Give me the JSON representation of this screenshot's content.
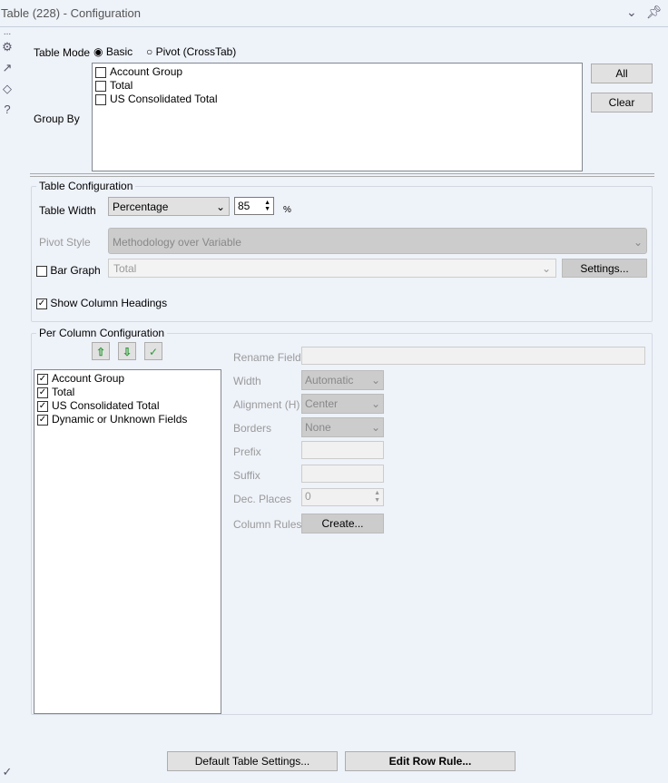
{
  "window": {
    "title": "Table (228) - Configuration",
    "ellipsis": "..."
  },
  "icons": {
    "collapse": "chevron-down-icon",
    "pin": "pin-icon",
    "side": [
      "gear-icon",
      "output-arrow-icon",
      "tag-icon",
      "help-icon"
    ],
    "bottom": "check-circle-icon"
  },
  "table_mode": {
    "label": "Table Mode",
    "options": [
      "Basic",
      "Pivot (CrossTab)"
    ],
    "selected": "Basic"
  },
  "group_by": {
    "label": "Group By",
    "items": [
      {
        "label": "Account Group",
        "checked": false
      },
      {
        "label": "Total",
        "checked": false
      },
      {
        "label": "US Consolidated Total",
        "checked": false
      }
    ],
    "all_label": "All",
    "clear_label": "Clear"
  },
  "table_config": {
    "legend": "Table Configuration",
    "width_label": "Table Width",
    "width_mode": "Percentage",
    "width_value": "85",
    "width_unit": "%",
    "pivot_style_label": "Pivot Style",
    "pivot_style_value": "Methodology over Variable",
    "bar_graph_label": "Bar Graph",
    "bar_graph_checked": false,
    "bar_graph_field": "Total",
    "settings_label": "Settings...",
    "show_headings_label": "Show Column Headings",
    "show_headings_checked": true
  },
  "per_column": {
    "legend": "Per Column Configuration",
    "fields": [
      {
        "label": "Account Group",
        "checked": true
      },
      {
        "label": "Total",
        "checked": true
      },
      {
        "label": "US Consolidated Total",
        "checked": true
      },
      {
        "label": "Dynamic or Unknown Fields",
        "checked": true
      }
    ],
    "rename_label": "Rename Field",
    "rename_value": "",
    "width_label": "Width",
    "width_value": "Automatic",
    "align_label": "Alignment (H)",
    "align_value": "Center",
    "borders_label": "Borders",
    "borders_value": "None",
    "prefix_label": "Prefix",
    "suffix_label": "Suffix",
    "dec_label": "Dec. Places",
    "dec_value": "0",
    "rules_label": "Column Rules",
    "create_label": "Create..."
  },
  "footer": {
    "default_label": "Default Table Settings...",
    "edit_row_label": "Edit Row Rule..."
  },
  "colors": {
    "background": "#eef2f9",
    "accent_green": "#2e9a3a"
  }
}
